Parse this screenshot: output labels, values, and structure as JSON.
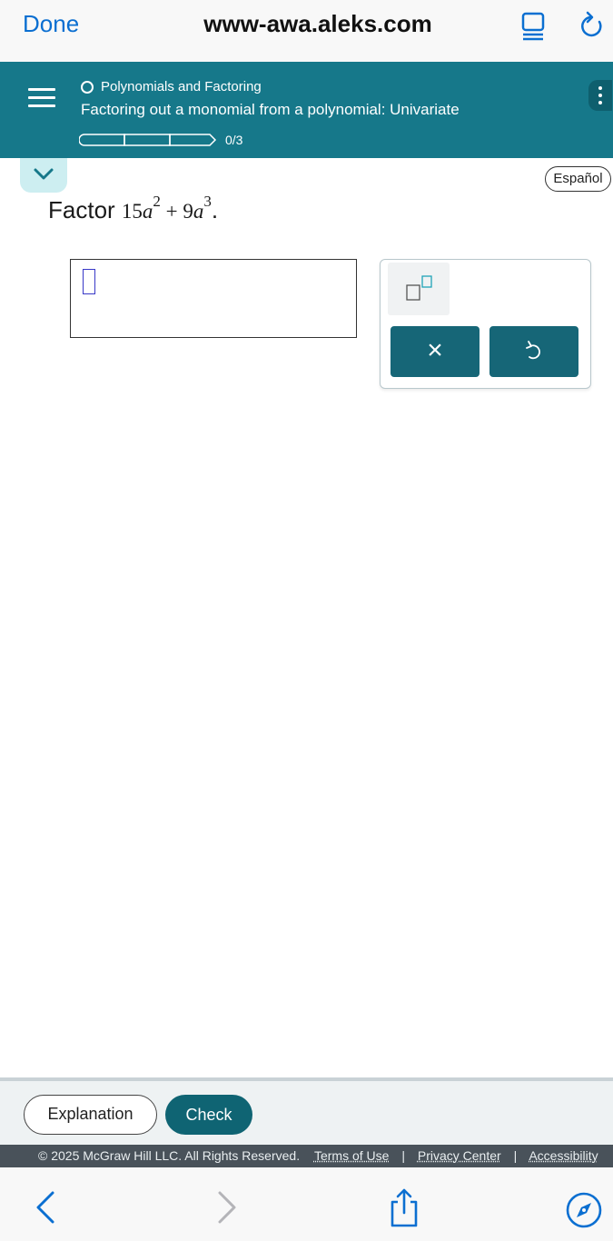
{
  "browser": {
    "done_label": "Done",
    "url": "www-awa.aleks.com",
    "icons": [
      "reader-icon",
      "reload-icon",
      "back-icon",
      "forward-icon",
      "share-icon",
      "compass-icon"
    ]
  },
  "header": {
    "topic": "Polynomials and Factoring",
    "subtopic": "Factoring out a monomial from a polynomial: Univariate",
    "progress_text": "0/3",
    "progress_fraction": 0
  },
  "espanol_label": "Español",
  "question": {
    "prefix": "Factor",
    "term1_coef": "15",
    "term1_var": "a",
    "term1_exp": "2",
    "plus": "+",
    "term2_coef": "9",
    "term2_var": "a",
    "term2_exp": "3",
    "period": "."
  },
  "keypad": {
    "clear_label": "×",
    "icons": [
      "exponent-icon",
      "undo-icon"
    ]
  },
  "footer": {
    "explanation_label": "Explanation",
    "check_label": "Check",
    "copyright": "© 2025 McGraw Hill LLC. All Rights Reserved.",
    "links": [
      "Terms of Use",
      "Privacy Center",
      "Accessibility"
    ],
    "separator": "|"
  },
  "colors": {
    "header_bg": "#16788a",
    "accent_button": "#166677",
    "check_button": "#0f6473",
    "browser_blue": "#0b6fd1",
    "copyright_bar": "#49525a"
  }
}
